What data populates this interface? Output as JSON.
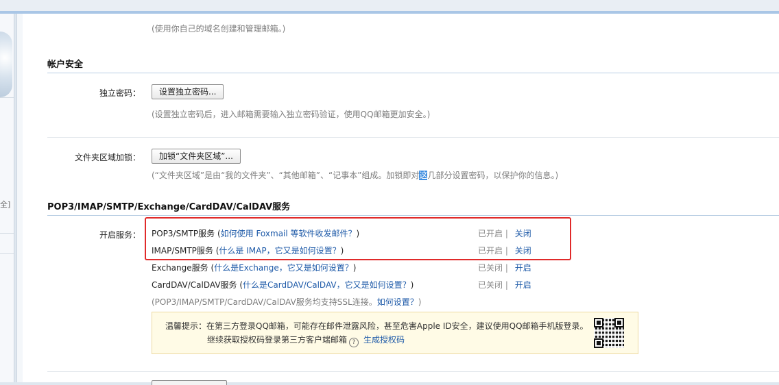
{
  "domain_hint": {
    "text": "(使用你自己的域名创建和管理邮箱。)"
  },
  "account_security": {
    "title": "帐户安全",
    "password": {
      "label": "独立密码：",
      "button": "设置独立密码...",
      "hint": "(设置独立密码后，进入邮箱需要输入独立密码验证，使用QQ邮箱更加安全。)"
    },
    "folder_lock": {
      "label": "文件夹区域加锁：",
      "button": "加锁“文件夹区域”...",
      "hint_before": "(“文件夹区域”是由“我的文件夹”、“其他邮箱”、“记事本”组成。加锁即对",
      "hint_highlight": "这",
      "hint_after": "几部分设置密码，以保护你的信息。)"
    }
  },
  "services": {
    "title": "POP3/IMAP/SMTP/Exchange/CardDAV/CalDAV服务",
    "label": "开启服务：",
    "items": [
      {
        "name": "POP3/SMTP服务",
        "paren_open": " (",
        "link": "如何使用 Foxmail 等软件收发邮件？",
        "paren_close": ")",
        "status": "已开启",
        "sep": "|",
        "action": "关闭"
      },
      {
        "name": "IMAP/SMTP服务",
        "paren_open": " (",
        "link": "什么是 IMAP，它又是如何设置？",
        "paren_close": ")",
        "status": "已开启",
        "sep": "|",
        "action": "关闭"
      },
      {
        "name": "Exchange服务",
        "paren_open": " (",
        "link": "什么是Exchange，它又是如何设置？",
        "paren_close": ")",
        "status": "已关闭",
        "sep": "|",
        "action": "开启"
      },
      {
        "name": "CardDAV/CalDAV服务",
        "paren_open": " (",
        "link": "什么是CardDAV/CalDAV，它又是如何设置？",
        "paren_close": ")",
        "status": "已关闭",
        "sep": "|",
        "action": "开启"
      }
    ],
    "ssl_note_text": "(POP3/IMAP/SMTP/CardDAV/CalDAV服务均支持SSL连接。",
    "ssl_note_link": "如何设置？",
    "ssl_note_close": ")"
  },
  "tip": {
    "line1": "温馨提示：在第三方登录QQ邮箱，可能存在邮件泄露风险，甚至危害Apple ID安全，建议使用QQ邮箱手机版登录。",
    "line2_text": "继续获取授权码登录第三方客户端邮箱",
    "help_glyph": "?",
    "line2_link": "生成授权码"
  },
  "left_pane": {
    "bracket": "全]"
  },
  "colors": {
    "link": "#1e5aa8",
    "highlight_box": "#e02a2a",
    "section_line": "#b8cde3",
    "tip_bg": "#fffbe6"
  }
}
